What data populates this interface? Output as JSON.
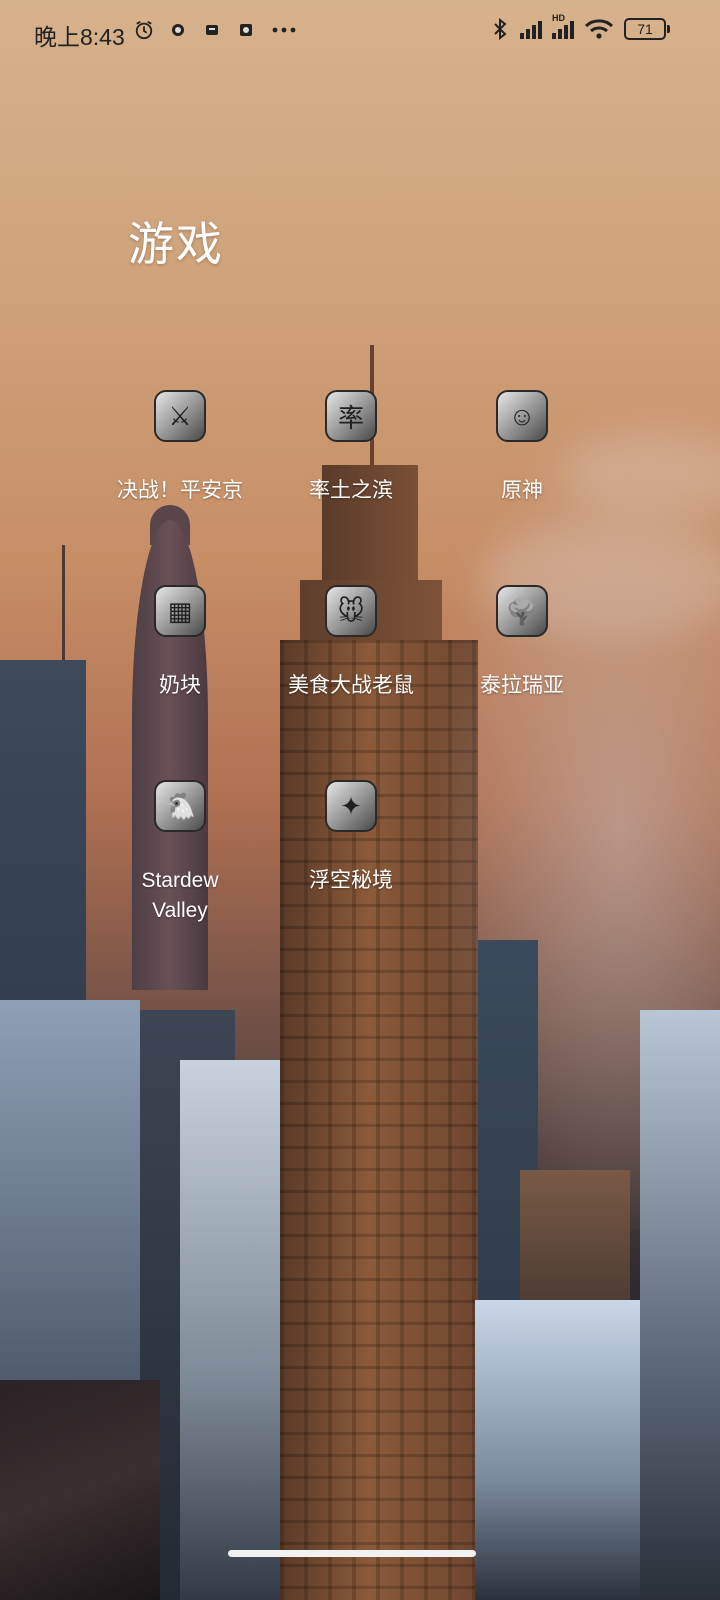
{
  "status_bar": {
    "time": "晚上8:43",
    "left_icons": [
      "alarm-clock-icon",
      "app-notification-icon",
      "message-notification-icon",
      "screen-record-icon",
      "more-dots-icon"
    ],
    "right_icons": [
      "bluetooth-icon",
      "cellular-signal-icon",
      "hd-signal-icon",
      "wifi-icon"
    ],
    "hd_label": "HD",
    "battery": "71"
  },
  "folder": {
    "title": "游戏",
    "apps": [
      {
        "label": "决战！平安京",
        "icon": "onmyoji-arena-app-icon",
        "glyph": "⚔"
      },
      {
        "label": "率土之滨",
        "icon": "infinite-borders-app-icon",
        "glyph": "率"
      },
      {
        "label": "原神",
        "icon": "genshin-impact-app-icon",
        "glyph": "☺"
      },
      {
        "label": "奶块",
        "icon": "block-craft-app-icon",
        "glyph": "▦"
      },
      {
        "label": "美食大战老鼠",
        "icon": "food-vs-mice-app-icon",
        "glyph": "🐭"
      },
      {
        "label": "泰拉瑞亚",
        "icon": "terraria-app-icon",
        "glyph": "🌳"
      },
      {
        "label": "Stardew\nValley",
        "icon": "stardew-valley-app-icon",
        "glyph": "🐔"
      },
      {
        "label": "浮空秘境",
        "icon": "floating-realm-app-icon",
        "glyph": "✦"
      }
    ]
  },
  "colors": {
    "label_text": "#ffffff",
    "status_text": "#222222",
    "home_indicator": "#f2f2f2"
  }
}
